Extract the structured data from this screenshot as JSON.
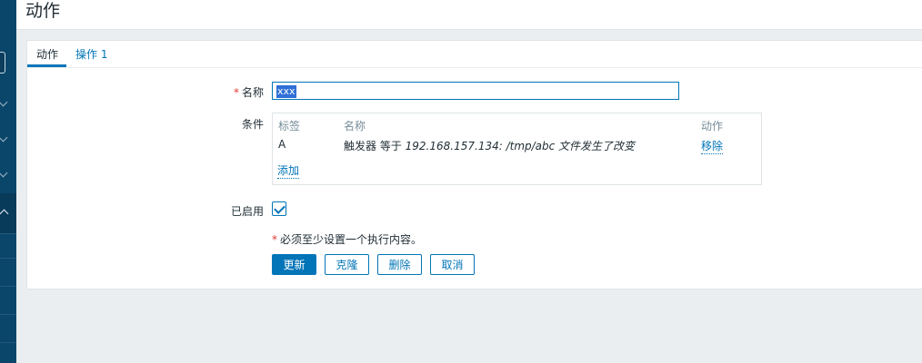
{
  "header": {
    "title": "动作"
  },
  "tabs": [
    {
      "label": "动作"
    },
    {
      "label": "操作 1"
    }
  ],
  "form": {
    "name_label": "名称",
    "name_value": "xxx",
    "conditions_label": "条件",
    "conditions_table": {
      "headers": [
        "标签",
        "名称",
        "动作"
      ],
      "rows": [
        {
          "tag": "A",
          "name_prefix": "触发器 等于",
          "name_value": "192.168.157.134: /tmp/abc 文件发生了改变",
          "action": "移除"
        }
      ],
      "add_link": "添加"
    },
    "enabled_label": "已启用",
    "enabled": true,
    "note_marker": "*",
    "note": "必须至少设置一个执行内容。",
    "required_marker": "*"
  },
  "buttons": {
    "update": "更新",
    "clone": "克隆",
    "delete": "删除",
    "cancel": "取消"
  },
  "colors": {
    "accent": "#0275b8",
    "required": "#e33734",
    "sidebar": "#0a466a"
  }
}
